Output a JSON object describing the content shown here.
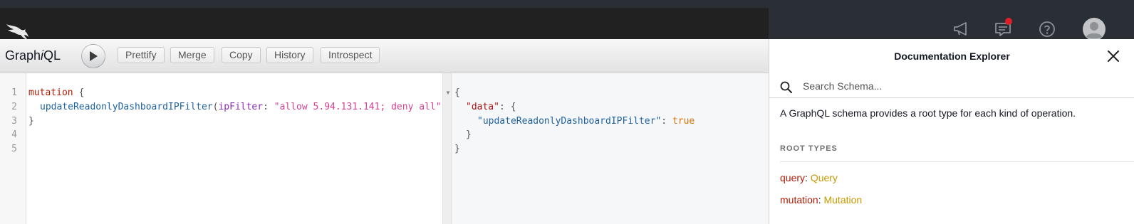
{
  "icons": {
    "logo": "falcon-logo-icon",
    "announcements": "megaphone-icon",
    "notifications": "message-icon",
    "help": "help-circle-icon",
    "avatar": "user-avatar-icon",
    "run": "play-icon",
    "close": "close-icon",
    "search": "search-icon"
  },
  "colors": {
    "topbar": "#212121",
    "notification_dot": "#e01e28",
    "type_link": "#ca9800",
    "field_name": "#b11a04"
  },
  "toolbar": {
    "title_prefix": "Graph",
    "title_italic": "i",
    "title_suffix": "QL",
    "buttons": [
      "Prettify",
      "Merge",
      "Copy",
      "History",
      "Introspect"
    ]
  },
  "editor": {
    "line_numbers": [
      "1",
      "2",
      "3",
      "4",
      "5"
    ],
    "line1_kw": "mutation",
    "line1_brace": " {",
    "line2_fn": "updateReadonlyDashboardIPFilter",
    "line2_open": "(",
    "line2_arg": "ipFilter",
    "line2_colon": ": ",
    "line2_str": "\"allow 5.94.131.141; deny all\"",
    "line2_close": ")",
    "line3": "}"
  },
  "result": {
    "open": "{",
    "data_key": "\"data\"",
    "data_colon": ": {",
    "field_key": "\"updateReadonlyDashboardIPFilter\"",
    "field_colon": ": ",
    "field_value": "true",
    "inner_close": "}",
    "outer_close": "}"
  },
  "docs": {
    "title": "Documentation Explorer",
    "search_placeholder": "Search Schema...",
    "description": "A GraphQL schema provides a root type for each kind of operation.",
    "section_title": "ROOT TYPES",
    "root_types": [
      {
        "field": "query",
        "type": "Query"
      },
      {
        "field": "mutation",
        "type": "Mutation"
      }
    ]
  }
}
